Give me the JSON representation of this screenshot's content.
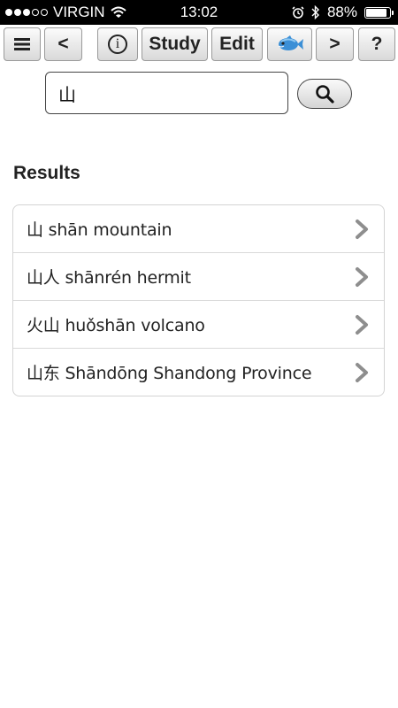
{
  "status_bar": {
    "carrier": "VIRGIN",
    "time": "13:02",
    "battery": "88%",
    "battery_level": 0.88,
    "signal_bars": 3,
    "signal_total": 5
  },
  "toolbar": {
    "menu_icon": "hamburger-icon",
    "back_label": "<",
    "info_label": "i",
    "study_label": "Study",
    "edit_label": "Edit",
    "fish_icon": "fish-icon",
    "forward_label": ">",
    "help_label": "?"
  },
  "search": {
    "value": "山",
    "button_icon": "magnifier-icon"
  },
  "results": {
    "heading": "Results",
    "items": [
      {
        "text": "山 shān mountain"
      },
      {
        "text": "山人 shānrén hermit"
      },
      {
        "text": "火山 huǒshān volcano"
      },
      {
        "text": "山东 Shāndōng Shandong Province"
      }
    ]
  },
  "colors": {
    "status_bar_bg": "#000000",
    "button_border": "#9a9a9a",
    "chevron": "#8e8e8e",
    "fish_body": "#3b8fd6"
  }
}
